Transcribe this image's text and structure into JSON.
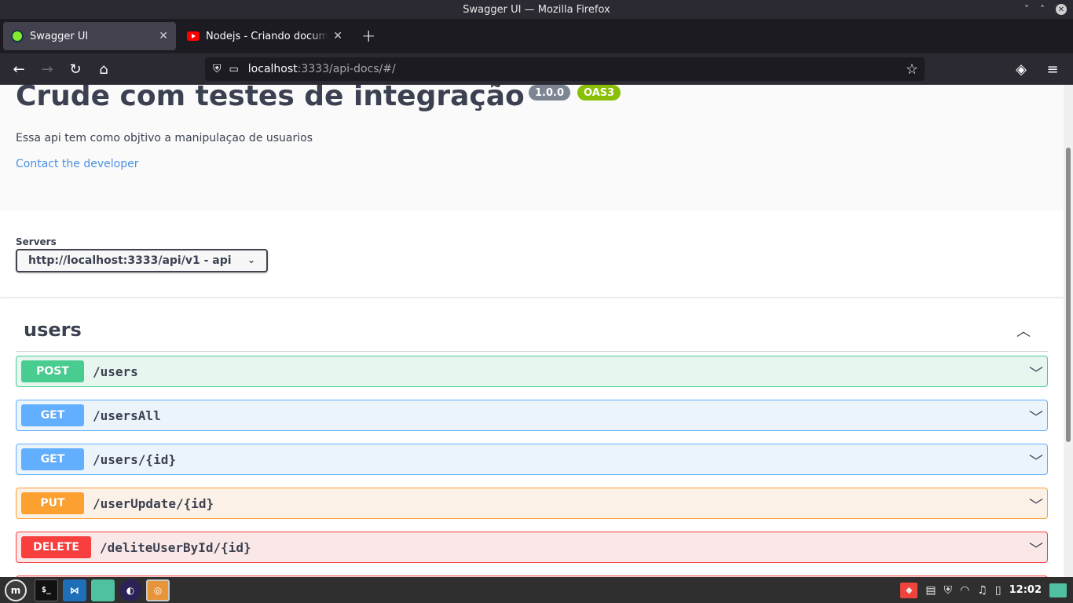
{
  "window": {
    "title": "Swagger UI — Mozilla Firefox",
    "controls": {
      "minimize": "˅",
      "restore": "˄",
      "close": "✕"
    }
  },
  "tabs": [
    {
      "label": "Swagger UI",
      "active": true,
      "close": "✕"
    },
    {
      "label": "Nodejs - Criando document",
      "active": false,
      "close": "✕"
    }
  ],
  "newtab_label": "+",
  "nav": {
    "back": "←",
    "forward": "→",
    "reload": "↻",
    "home": "⌂",
    "url_host": "localhost",
    "url_rest": ":3333/api-docs/#/",
    "bookmark": "☆",
    "pocket": "◈",
    "menu": "≡"
  },
  "info": {
    "title": "Crude com testes de integração",
    "version": "1.0.0",
    "oas": "OAS3",
    "description": "Essa api tem como objtivo a manipulaçao de usuarios",
    "contact": "Contact the developer"
  },
  "servers": {
    "label": "Servers",
    "selected": "http://localhost:3333/api/v1 - api",
    "chevron": "⌄"
  },
  "tag": {
    "name": "users",
    "toggle": "︿"
  },
  "operations": [
    {
      "method": "POST",
      "path": "/users",
      "chevron": "﹀"
    },
    {
      "method": "GET",
      "path": "/usersAll",
      "chevron": "﹀"
    },
    {
      "method": "GET",
      "path": "/users/{id}",
      "chevron": "﹀"
    },
    {
      "method": "PUT",
      "path": "/userUpdate/{id}",
      "chevron": "﹀"
    },
    {
      "method": "DELETE",
      "path": "/deliteUserById/{id}",
      "chevron": "﹀"
    }
  ],
  "taskbar": {
    "terminal_label": "$_",
    "clock": "12:02"
  },
  "colors": {
    "post": "#49cc90",
    "get": "#61affe",
    "put": "#fca130",
    "delete": "#f93e3e",
    "link": "#4990e2"
  }
}
